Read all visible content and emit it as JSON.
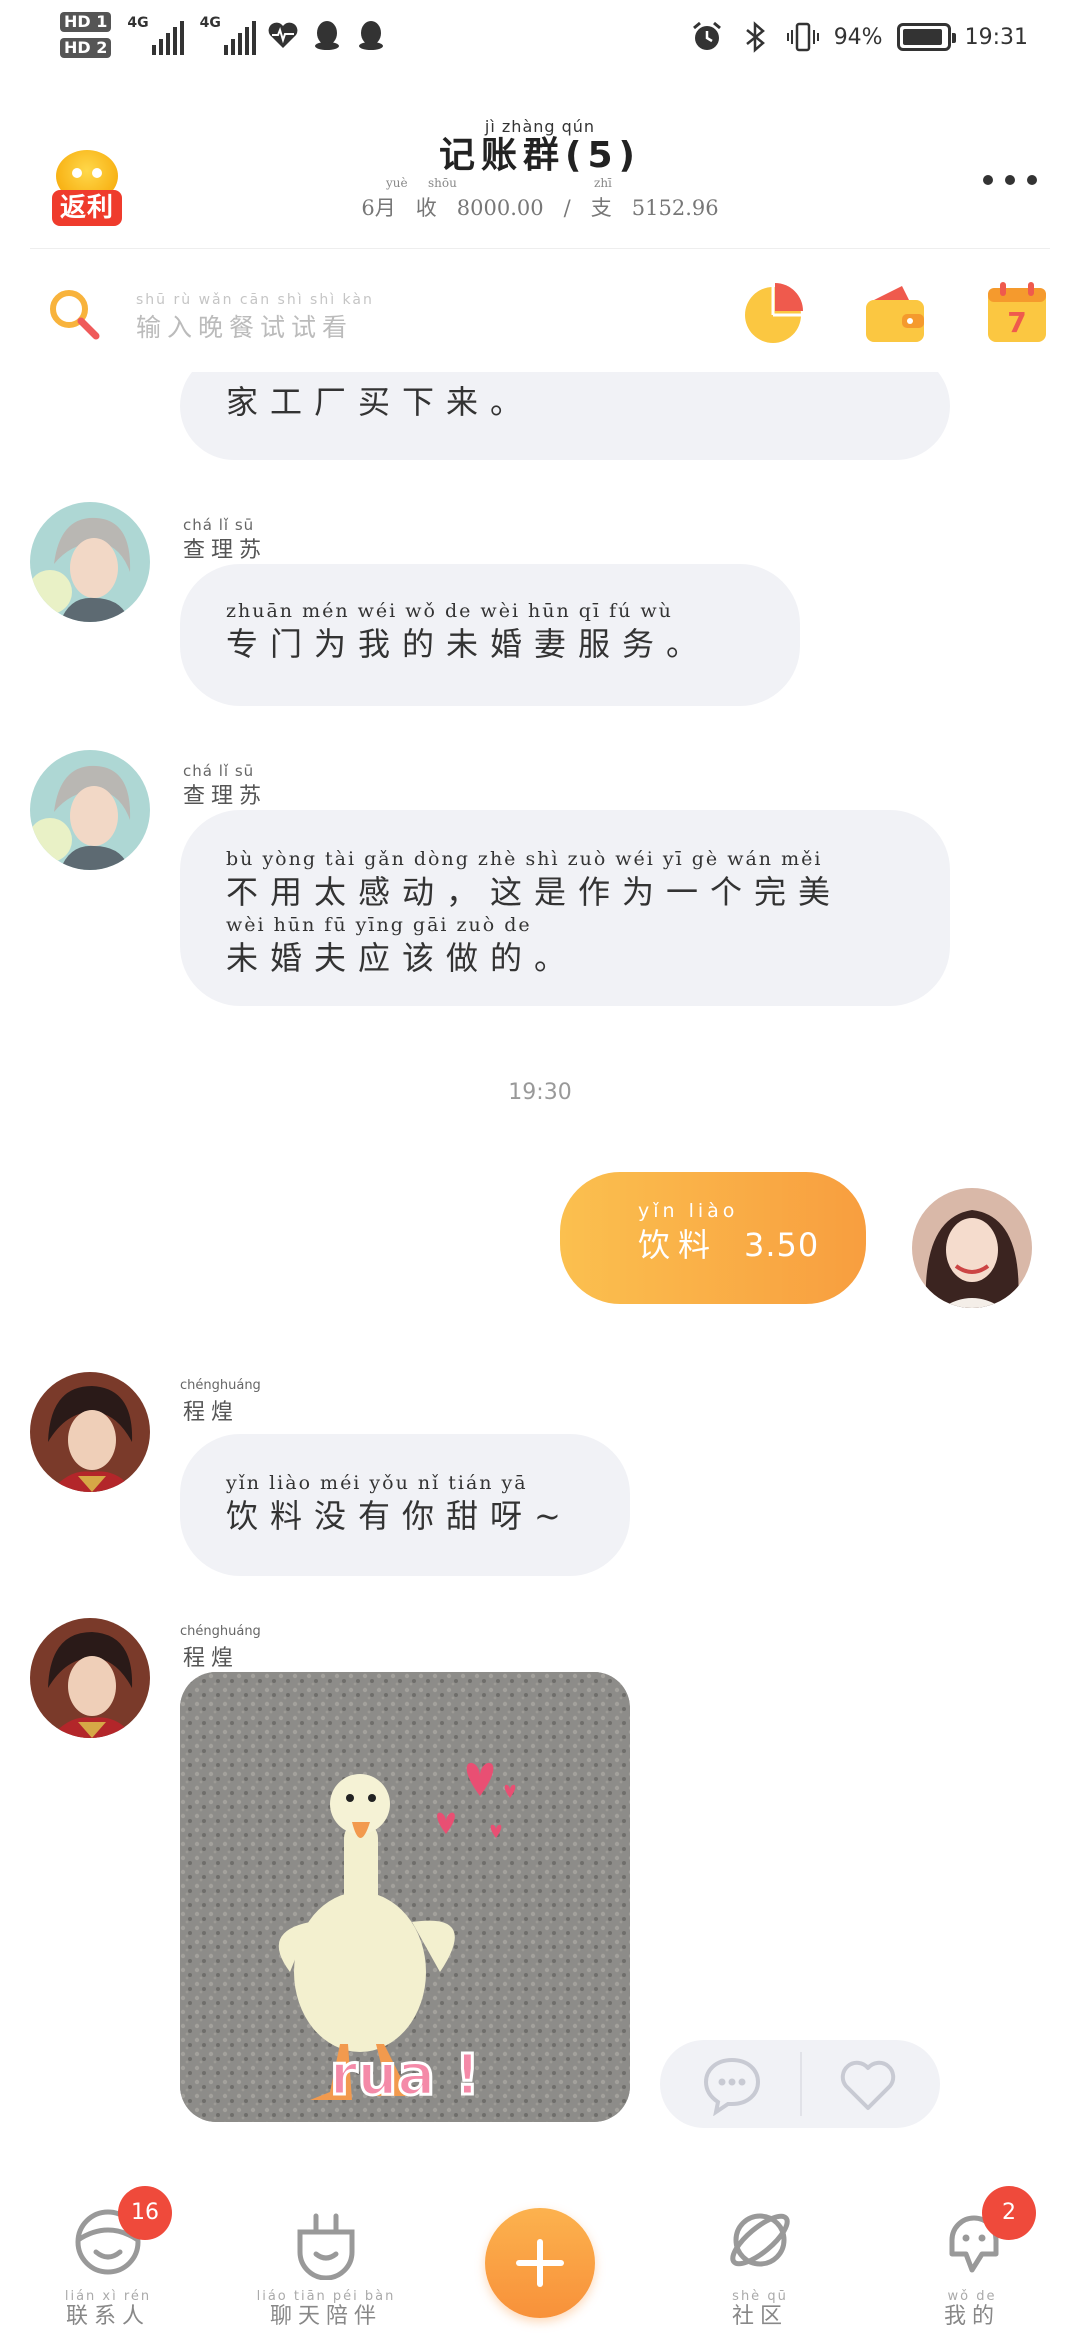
{
  "status_bar": {
    "sim1": "HD 1",
    "sim2": "HD 2",
    "network1": "4G",
    "network2": "4G",
    "battery_percent": "94%",
    "battery_level": 0.94,
    "time": "19:31",
    "icons": [
      "heart-rate-icon",
      "qq-icon",
      "qq-icon",
      "alarm-icon",
      "bluetooth-icon",
      "vibrate-icon"
    ]
  },
  "header": {
    "rebate_badge": "返利",
    "title_pinyin": "jì  zhàng qún",
    "title": "记账群(5)",
    "subtitle": {
      "month": "6月",
      "income_py": "shōu",
      "income_label": "收",
      "income_value": "8000.00",
      "sep": "/",
      "expense_py": "zhī",
      "expense_label": "支",
      "expense_value": "5152.96",
      "month_py": "yuè"
    }
  },
  "search": {
    "placeholder_py": "shū  rù  wǎn cān  shì  shì  kàn",
    "placeholder": "输入晚餐试试看"
  },
  "tools": [
    "pie-chart-icon",
    "wallet-icon",
    "calendar-icon"
  ],
  "calendar_day": "7",
  "chat": {
    "partial_message": "家工厂买下来。",
    "messages": [
      {
        "sender_py": "chá  lǐ  sū",
        "sender": "查理苏",
        "py_lines": [
          "zhuān mén  wéi  wǒ   de   wèi  hūn   qī   fú   wù"
        ],
        "text_lines": [
          "专门为我的未婚妻服务。"
        ]
      },
      {
        "sender_py": "chá  lǐ  sū",
        "sender": "查理苏",
        "py_lines": [
          "bù  yòng  tài  gǎn dòng       zhè  shì  zuò  wéi   yī   gè  wán měi",
          "wèi  hūn  fū  yīng gāi  zuò   de"
        ],
        "text_lines": [
          "不用太感动，这是作为一个完美",
          "未婚夫应该做的。"
        ]
      }
    ],
    "timestamp": "19:30",
    "my_expense": {
      "py": "yǐn  liào",
      "label": "饮料",
      "amount": "3.50"
    },
    "messages2": [
      {
        "sender_py": "chénghuáng",
        "sender": "程煌",
        "py_lines": [
          "yǐn  liào  méi  yǒu   nǐ   tián   yā"
        ],
        "text_lines": [
          "饮料没有你甜呀~"
        ]
      },
      {
        "sender_py": "chénghuáng",
        "sender": "程煌",
        "sticker_text": "rua !"
      }
    ]
  },
  "bottom_nav": [
    {
      "py": "lián  xì  rén",
      "label": "联系人",
      "badge": "16",
      "icon": "contacts-icon"
    },
    {
      "py": "liáo tiān péi bàn",
      "label": "聊天陪伴",
      "icon": "chat-companion-icon"
    },
    {
      "label": "",
      "icon": "add-icon"
    },
    {
      "py": "shè  qū",
      "label": "社区",
      "icon": "planet-icon"
    },
    {
      "py": "wǒ  de",
      "label": "我的",
      "badge": "2",
      "icon": "profile-icon"
    }
  ],
  "colors": {
    "accent_orange": "#f89e3f",
    "bubble_gray": "#f1f2f6",
    "badge_red": "#ef4a3b"
  }
}
